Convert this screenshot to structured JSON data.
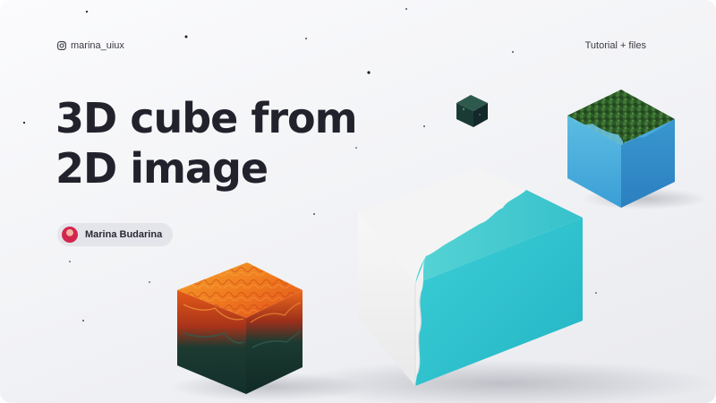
{
  "handle": {
    "text": "marina_uiux",
    "icon": "instagram-icon"
  },
  "tag": "Tutorial + files",
  "headline": {
    "line1": "3D cube from",
    "line2": "2D image"
  },
  "author": {
    "name": "Marina Budarina"
  },
  "colors": {
    "text_dark": "#22222c",
    "turquoise": "#34c3cc",
    "sky_blue": "#4aa8dc",
    "orange": "#f0721d",
    "dark_green": "#17392f",
    "chip_bg": "#e4e5ea"
  }
}
